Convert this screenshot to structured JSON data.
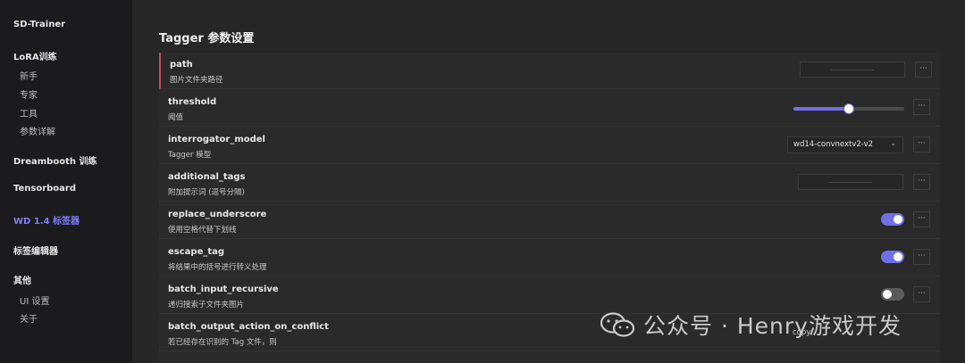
{
  "sidebar": {
    "brand": "SD-Trainer",
    "lora": "LoRA训练",
    "lora_items": [
      "新手",
      "专家",
      "工具",
      "参数详解"
    ],
    "dreambooth": "Dreambooth 训练",
    "tensorboard": "Tensorboard",
    "tagger": "WD 1.4 标签器",
    "tag_editor": "标签编辑器",
    "other": "其他",
    "other_items": [
      "UI 设置",
      "关于"
    ]
  },
  "main": {
    "title": "Tagger 参数设置",
    "rows": [
      {
        "name": "path",
        "desc": "图片文件夹路径",
        "control": "text"
      },
      {
        "name": "threshold",
        "desc": "阈值",
        "control": "slider",
        "value_fraction": 0.5
      },
      {
        "name": "interrogator_model",
        "desc": "Tagger 模型",
        "control": "select",
        "value": "wd14-convnextv2-v2"
      },
      {
        "name": "additional_tags",
        "desc": "附加提示词 (逗号分隔)",
        "control": "text"
      },
      {
        "name": "replace_underscore",
        "desc": "使用空格代替下划线",
        "control": "toggle",
        "on": true
      },
      {
        "name": "escape_tag",
        "desc": "将结果中的括号进行转义处理",
        "control": "toggle",
        "on": true
      },
      {
        "name": "batch_input_recursive",
        "desc": "递归搜索子文件夹图片",
        "control": "toggle",
        "on": false
      },
      {
        "name": "batch_output_action_on_conflict",
        "desc": "若已经存在识别的 Tag 文件，则",
        "control": "select",
        "value": "copy"
      }
    ],
    "more_label": "···"
  },
  "watermark": {
    "text": "公众号 · Henry游戏开发"
  },
  "colors": {
    "accent": "#6f70e6",
    "active_nav": "#7b7ef8",
    "marker": "#c94a5c"
  }
}
